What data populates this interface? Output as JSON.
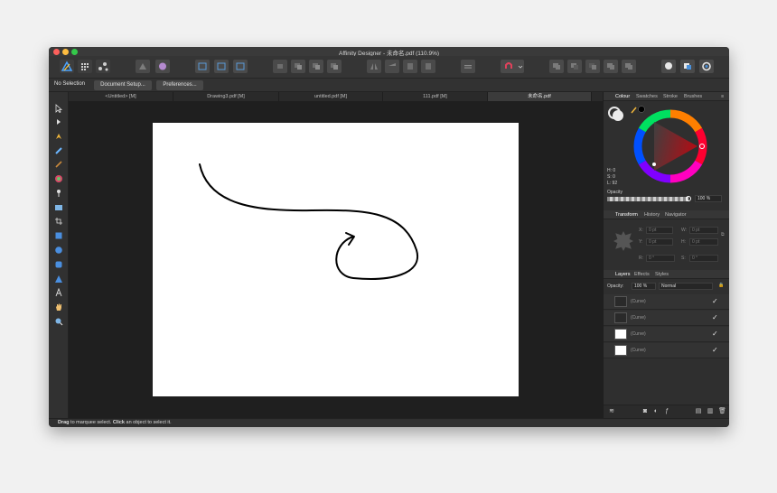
{
  "window": {
    "title": "Affinity Designer - 未命名.pdf (110.9%)"
  },
  "context_bar": {
    "selection": "No Selection",
    "document_setup": "Document Setup...",
    "preferences": "Preferences..."
  },
  "tabs": [
    "<Untitled> [M]",
    "Drawing3.pdf [M]",
    "untitled.pdf [M]",
    "111.pdf [M]",
    "未命名.pdf"
  ],
  "colour_panel": {
    "tabs": [
      "Colour",
      "Swatches",
      "Stroke",
      "Brushes"
    ],
    "h": "H: 0",
    "s": "S: 0",
    "l": "L: 92",
    "opacity_label": "Opacity",
    "opacity_value": "100 %"
  },
  "transform_panel": {
    "tabs": [
      "Transform",
      "History",
      "Navigator"
    ],
    "x_label": "X:",
    "x_value": "0 pt",
    "y_label": "Y:",
    "y_value": "0 pt",
    "w_label": "W:",
    "w_value": "0 pt",
    "h_label": "H:",
    "h_value": "0 pt",
    "r_label": "R:",
    "r_value": "0 °",
    "s_label": "S:",
    "s_value": "0 °"
  },
  "layers_panel": {
    "tabs": [
      "Layers",
      "Effects",
      "Styles"
    ],
    "opacity_label": "Opacity:",
    "opacity_value": "100 %",
    "blend_mode": "Normal",
    "layers": [
      {
        "name": "(Curve)",
        "checked": "✓"
      },
      {
        "name": "(Curve)",
        "checked": "✓"
      },
      {
        "name": "(Curve)",
        "checked": "✓"
      },
      {
        "name": "(Curve)",
        "checked": "✓"
      }
    ]
  },
  "status": {
    "drag": "Drag",
    "text1": " to marquee select. ",
    "click": "Click",
    "text2": " an object to select it."
  },
  "colors": {
    "window_bg": "#2d2d2d",
    "canvas_bg": "#1f1f1f",
    "document": "#ffffff",
    "accent": "#4a90d9"
  }
}
